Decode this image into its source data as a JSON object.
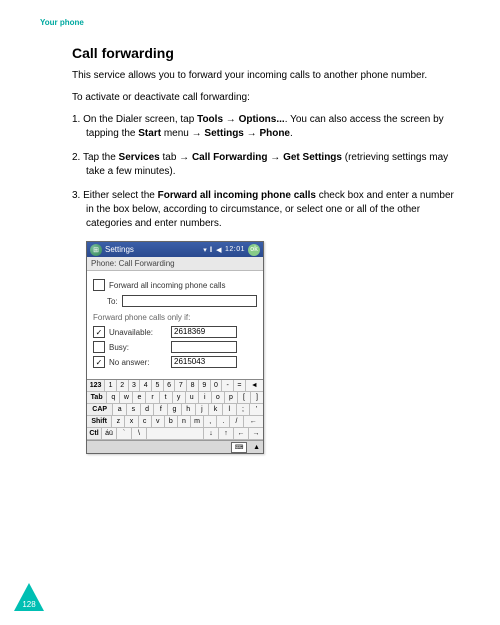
{
  "header": {
    "section": "Your phone"
  },
  "title": "Call forwarding",
  "intro": "This service allows you to forward your incoming calls to another phone number.",
  "subintro": "To activate or deactivate call forwarding:",
  "steps": [
    {
      "num": "1.",
      "parts": [
        "On the Dialer screen, tap ",
        "Tools",
        " → ",
        "Options...",
        ". You can also access the screen by tapping the ",
        "Start",
        " menu → ",
        "Settings",
        " → ",
        "Phone",
        "."
      ]
    },
    {
      "num": "2.",
      "parts": [
        "Tap the ",
        "Services",
        " tab → ",
        "Call Forwarding",
        " → ",
        "Get Settings",
        " (retrieving settings may take a few minutes)."
      ]
    },
    {
      "num": "3.",
      "parts": [
        "Either select the ",
        "Forward all incoming phone calls",
        " check box and enter a number in the box below, according to circumstance, or select one or all of the other categories and enter numbers."
      ]
    }
  ],
  "device": {
    "titlebar": {
      "app": "Settings",
      "signal": "▾ ‖",
      "speaker": "◀",
      "time": "12:01",
      "ok": "ok"
    },
    "subbar": "Phone: Call Forwarding",
    "forward_all_label": "Forward all incoming phone calls",
    "to_label": "To:",
    "to_value": "",
    "only_if_label": "Forward phone calls only if:",
    "rows": [
      {
        "checked": true,
        "label": "Unavailable:",
        "value": "2618369"
      },
      {
        "checked": false,
        "label": "Busy:",
        "value": ""
      },
      {
        "checked": true,
        "label": "No answer:",
        "value": "2615043"
      }
    ],
    "keyboard": {
      "r1": [
        "123",
        "1",
        "2",
        "3",
        "4",
        "5",
        "6",
        "7",
        "8",
        "9",
        "0",
        "-",
        "=",
        "◄"
      ],
      "r2": [
        "Tab",
        "q",
        "w",
        "e",
        "r",
        "t",
        "y",
        "u",
        "i",
        "o",
        "p",
        "[",
        "]"
      ],
      "r3": [
        "CAP",
        "a",
        "s",
        "d",
        "f",
        "g",
        "h",
        "j",
        "k",
        "l",
        ";",
        "'"
      ],
      "r4": [
        "Shift",
        "z",
        "x",
        "c",
        "v",
        "b",
        "n",
        "m",
        ",",
        ".",
        "/",
        "←"
      ],
      "r5": [
        "Ctl",
        "áü",
        "`",
        "\\",
        " ",
        "↓",
        "↑",
        "←",
        "→"
      ]
    },
    "bottombar": {
      "kb": "⌨",
      "up": "▲"
    }
  },
  "page_number": "128"
}
